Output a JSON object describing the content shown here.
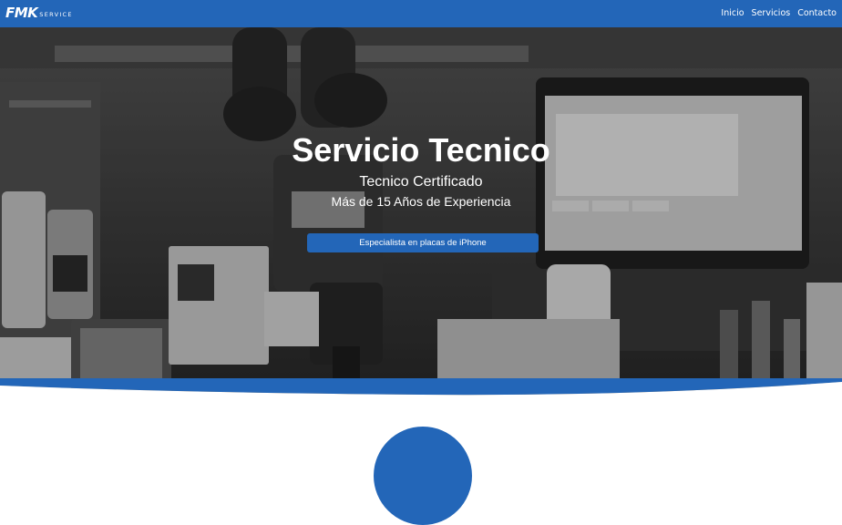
{
  "brand": {
    "logo_main": "FMK",
    "logo_sub": "SERVICE"
  },
  "nav": {
    "items": [
      {
        "label": "Inicio"
      },
      {
        "label": "Servicios"
      },
      {
        "label": "Contacto"
      }
    ]
  },
  "hero": {
    "title": "Servicio Tecnico",
    "subtitle_1": "Tecnico Certificado",
    "subtitle_2": "Más de 15 Años de Experiencia",
    "cta_label": "Especialista en placas de iPhone",
    "background_image": "grayscale-electronics-repair-workbench"
  },
  "colors": {
    "primary": "#2366b8",
    "text_on_primary": "#ffffff",
    "page_background": "#ffffff"
  }
}
